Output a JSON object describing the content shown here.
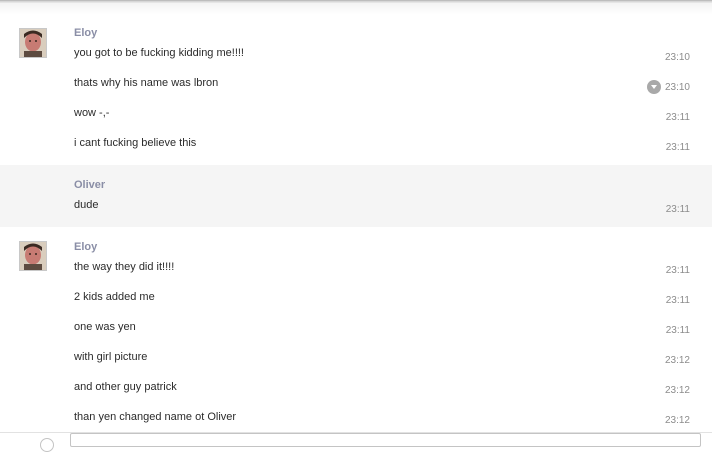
{
  "groups": [
    {
      "sender": "Eloy",
      "avatar": "avatar-eloy",
      "messages": [
        {
          "text": "you got to be fucking kidding me!!!!",
          "time": "23:10"
        },
        {
          "text": "thats why his name was lbron",
          "time": "23:10"
        },
        {
          "text": "wow -,-",
          "time": "23:11"
        },
        {
          "text": "i cant fucking believe this",
          "time": "23:11"
        }
      ]
    },
    {
      "sender": "Oliver",
      "messages": [
        {
          "text": "dude",
          "time": "23:11"
        }
      ]
    },
    {
      "sender": "Eloy",
      "avatar": "avatar-eloy",
      "messages": [
        {
          "text": "the way they did it!!!!",
          "time": "23:11"
        },
        {
          "text": "2 kids added me",
          "time": "23:11"
        },
        {
          "text": "one was yen",
          "time": "23:11"
        },
        {
          "text": "with girl picture",
          "time": "23:12"
        },
        {
          "text": "and other guy patrick",
          "time": "23:12"
        },
        {
          "text": "than yen changed name ot Oliver",
          "time": "23:12"
        }
      ]
    }
  ],
  "icons": {
    "message_menu": "chevron-down-icon"
  },
  "colors": {
    "sender_name": "#8a8ea6",
    "alt_row_background": "#f5f5f5",
    "timestamp": "#8c8c8c"
  }
}
